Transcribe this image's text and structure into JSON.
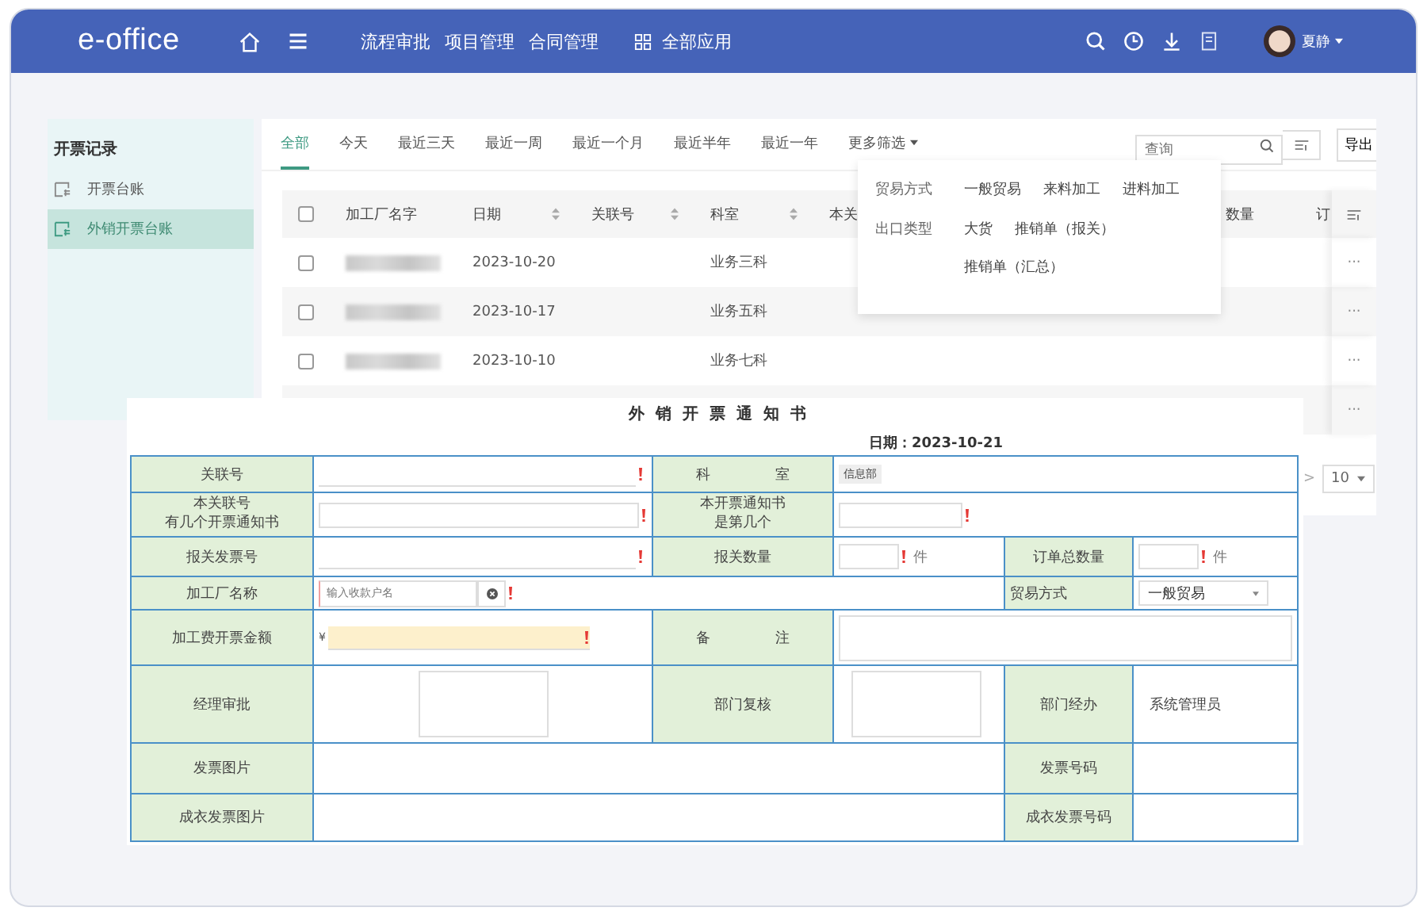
{
  "header": {
    "logo": "e-office",
    "nav": [
      {
        "label": "流程审批"
      },
      {
        "label": "项目管理"
      },
      {
        "label": "合同管理"
      }
    ],
    "apps": "全部应用",
    "user": "夏静"
  },
  "sidebar": {
    "title": "开票记录",
    "items": [
      {
        "label": "开票台账",
        "selected": false
      },
      {
        "label": "外销开票台账",
        "selected": true
      }
    ]
  },
  "filters": {
    "tabs": [
      {
        "label": "全部",
        "selected": true
      },
      {
        "label": "今天",
        "selected": false
      },
      {
        "label": "最近三天",
        "selected": false
      },
      {
        "label": "最近一周",
        "selected": false
      },
      {
        "label": "最近一个月",
        "selected": false
      },
      {
        "label": "最近半年",
        "selected": false
      },
      {
        "label": "最近一年",
        "selected": false
      }
    ],
    "more": "更多筛选",
    "search_placeholder": "查询",
    "export": "导出"
  },
  "more_filter_menu": {
    "groups": [
      {
        "label": "贸易方式",
        "options": [
          "一般贸易",
          "来料加工",
          "进料加工"
        ]
      },
      {
        "label": "出口类型",
        "options": [
          "大货",
          "推销单（报关）",
          "推销单（汇总）"
        ]
      }
    ]
  },
  "table": {
    "columns": [
      {
        "label": "加工厂名字",
        "sortable": false
      },
      {
        "label": "日期",
        "sortable": true
      },
      {
        "label": "关联号",
        "sortable": true
      },
      {
        "label": "科室",
        "sortable": true
      },
      {
        "label": "本关"
      },
      {
        "label": "数量",
        "sortable": false
      },
      {
        "label": "订"
      }
    ],
    "all_checked": false,
    "rows": [
      {
        "checked": false,
        "date": "2023-10-20",
        "dept": "业务三科",
        "actions": "···"
      },
      {
        "checked": false,
        "date": "2023-10-17",
        "dept": "业务五科",
        "actions": "···"
      },
      {
        "checked": false,
        "date": "2023-10-10",
        "dept": "业务七科",
        "actions": "···"
      },
      {
        "actions": "···"
      }
    ]
  },
  "pagination": {
    "next": ">",
    "page_size": "10"
  },
  "notice_form": {
    "title": "外销开票通知书",
    "date": "日期：2023-10-21",
    "related_no": {
      "label": "关联号",
      "required": true
    },
    "dept": {
      "label": "科 室",
      "value": "信息部"
    },
    "notice_count": {
      "label_lines": [
        "本关联号",
        "有几个开票通知书"
      ],
      "required": true
    },
    "notice_index": {
      "label_lines": [
        "本开票通知书",
        "是第几个"
      ],
      "required": true
    },
    "customs_invoice_no": {
      "label": "报关发票号",
      "required": true
    },
    "customs_qty": {
      "label": "报关数量",
      "unit": "件",
      "required": true
    },
    "order_total_qty": {
      "label": "订单总数量",
      "unit": "件",
      "required": true
    },
    "factory_name": {
      "label": "加工厂名称",
      "placeholder": "输入收款户名",
      "required": true
    },
    "trade_mode": {
      "label": "贸易方式",
      "value": "一般贸易"
    },
    "processing_fee": {
      "label": "加工费开票金额",
      "currency": "¥",
      "required": true
    },
    "remarks": {
      "label": "备 注"
    },
    "manager_approval": {
      "label": "经理审批"
    },
    "dept_review": {
      "label": "部门复核"
    },
    "dept_handler": {
      "label": "部门经办",
      "value": "系统管理员"
    },
    "invoice_image": {
      "label": "发票图片"
    },
    "invoice_no": {
      "label": "发票号码"
    },
    "garment_invoice_image": {
      "label": "成衣发票图片"
    },
    "garment_invoice_no": {
      "label": "成衣发票号码"
    }
  }
}
